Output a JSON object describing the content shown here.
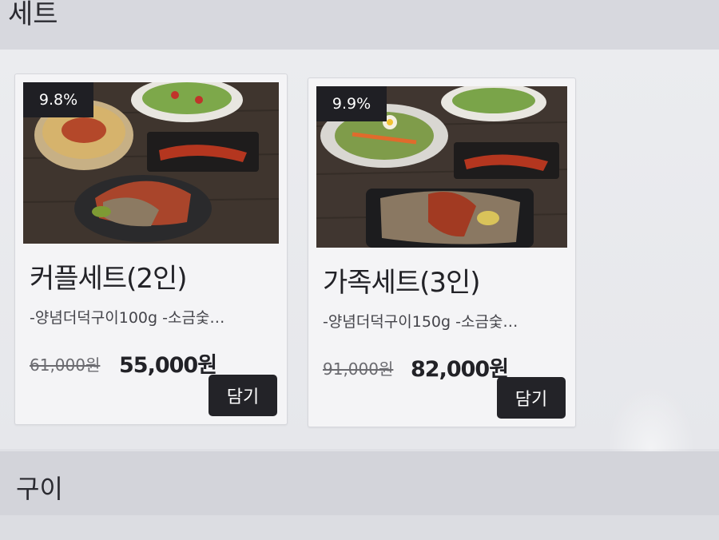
{
  "sections": {
    "top_title": "세트",
    "bottom_title": "구이"
  },
  "products": [
    {
      "badge": "9.8%",
      "name": "커플세트(2인)",
      "description": "-양념더덕구이100g -소금숯…",
      "original_price": "61,000원",
      "price": "55,000원",
      "button": "담기"
    },
    {
      "badge": "9.9%",
      "name": "가족세트(3인)",
      "description": "-양념더덕구이150g -소금숯…",
      "original_price": "91,000원",
      "price": "82,000원",
      "button": "담기"
    }
  ],
  "colors": {
    "button_bg": "#232328",
    "badge_bg": "#1f1f24",
    "card_bg": "#f4f4f6"
  }
}
